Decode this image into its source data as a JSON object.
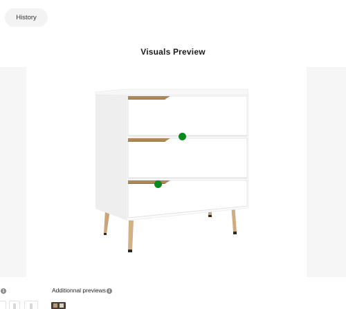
{
  "header": {
    "history_label": "History"
  },
  "preview": {
    "title": "Visuals Preview",
    "hotspot_color": "#0a8a1e"
  },
  "footer": {
    "additional_previews_label": "Additionnal previews",
    "info_icon": "info-icon"
  }
}
